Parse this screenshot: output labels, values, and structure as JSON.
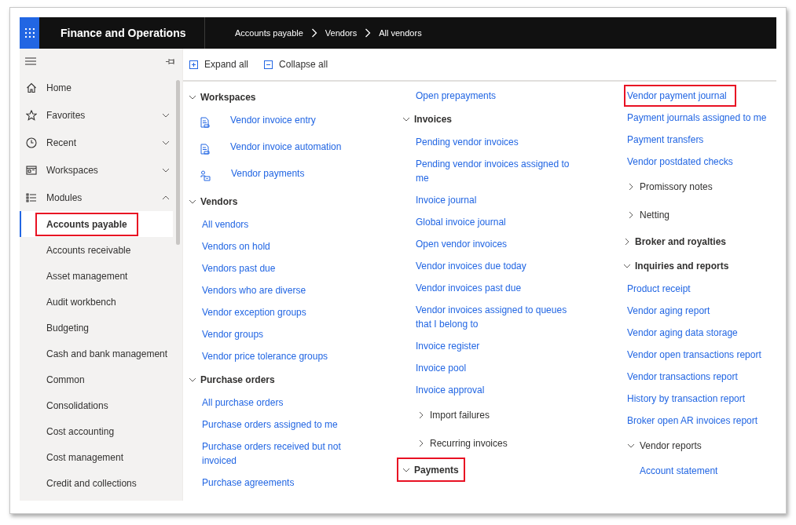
{
  "top_bar": {
    "app_title": "Finance and Operations",
    "breadcrumb": [
      "Accounts payable",
      "Vendors",
      "All vendors"
    ]
  },
  "nav": {
    "items": [
      {
        "kind": "link",
        "label": "Home"
      },
      {
        "kind": "expander",
        "label": "Favorites",
        "expanded": false
      },
      {
        "kind": "expander",
        "label": "Recent",
        "expanded": false
      },
      {
        "kind": "expander",
        "label": "Workspaces",
        "expanded": false
      },
      {
        "kind": "expander",
        "label": "Modules",
        "expanded": true
      }
    ],
    "modules": [
      {
        "label": "Accounts payable",
        "selected": true,
        "highlighted": true
      },
      {
        "label": "Accounts receivable",
        "selected": false,
        "highlighted": false
      },
      {
        "label": "Asset management",
        "selected": false,
        "highlighted": false
      },
      {
        "label": "Audit workbench",
        "selected": false,
        "highlighted": false
      },
      {
        "label": "Budgeting",
        "selected": false,
        "highlighted": false
      },
      {
        "label": "Cash and bank management",
        "selected": false,
        "highlighted": false
      },
      {
        "label": "Common",
        "selected": false,
        "highlighted": false
      },
      {
        "label": "Consolidations",
        "selected": false,
        "highlighted": false
      },
      {
        "label": "Cost accounting",
        "selected": false,
        "highlighted": false
      },
      {
        "label": "Cost management",
        "selected": false,
        "highlighted": false
      },
      {
        "label": "Credit and collections",
        "selected": false,
        "highlighted": false
      }
    ]
  },
  "toolbar": {
    "expand_all": "Expand all",
    "collapse_all": "Collapse all"
  },
  "columns": [
    {
      "items": [
        {
          "kind": "header",
          "label": "Workspaces",
          "expanded": true,
          "highlighted": false
        },
        {
          "kind": "workspace",
          "label": "Vendor invoice entry",
          "highlighted": false
        },
        {
          "kind": "workspace",
          "label": "Vendor invoice automation",
          "highlighted": false
        },
        {
          "kind": "workspace",
          "label": "Vendor payments",
          "highlighted": false
        },
        {
          "kind": "header",
          "label": "Vendors",
          "expanded": true,
          "highlighted": false
        },
        {
          "kind": "link",
          "label": "All vendors",
          "highlighted": false
        },
        {
          "kind": "link",
          "label": "Vendors on hold",
          "highlighted": false
        },
        {
          "kind": "link",
          "label": "Vendors past due",
          "highlighted": false
        },
        {
          "kind": "link",
          "label": "Vendors who are diverse",
          "highlighted": false
        },
        {
          "kind": "link",
          "label": "Vendor exception groups",
          "highlighted": false
        },
        {
          "kind": "link",
          "label": "Vendor groups",
          "highlighted": false
        },
        {
          "kind": "link",
          "label": "Vendor price tolerance groups",
          "highlighted": false
        },
        {
          "kind": "header",
          "label": "Purchase orders",
          "expanded": true,
          "highlighted": false
        },
        {
          "kind": "link",
          "label": "All purchase orders",
          "highlighted": false
        },
        {
          "kind": "link",
          "label": "Purchase orders assigned to me",
          "highlighted": false
        },
        {
          "kind": "link",
          "label": "Purchase orders received but not invoiced",
          "highlighted": false
        },
        {
          "kind": "link",
          "label": "Purchase agreements",
          "highlighted": false
        }
      ]
    },
    {
      "items": [
        {
          "kind": "link",
          "label": "Open prepayments",
          "highlighted": false
        },
        {
          "kind": "header",
          "label": "Invoices",
          "expanded": true,
          "highlighted": false
        },
        {
          "kind": "link",
          "label": "Pending vendor invoices",
          "highlighted": false
        },
        {
          "kind": "link",
          "label": "Pending vendor invoices assigned to me",
          "highlighted": false
        },
        {
          "kind": "link",
          "label": "Invoice journal",
          "highlighted": false
        },
        {
          "kind": "link",
          "label": "Global invoice journal",
          "highlighted": false
        },
        {
          "kind": "link",
          "label": "Open vendor invoices",
          "highlighted": false
        },
        {
          "kind": "link",
          "label": "Vendor invoices due today",
          "highlighted": false
        },
        {
          "kind": "link",
          "label": "Vendor invoices past due",
          "highlighted": false
        },
        {
          "kind": "link",
          "label": "Vendor invoices assigned to queues that I belong to",
          "highlighted": false
        },
        {
          "kind": "link",
          "label": "Invoice register",
          "highlighted": false
        },
        {
          "kind": "link",
          "label": "Invoice pool",
          "highlighted": false
        },
        {
          "kind": "link",
          "label": "Invoice approval",
          "highlighted": false
        },
        {
          "kind": "group",
          "label": "Import failures",
          "expanded": false,
          "highlighted": false
        },
        {
          "kind": "group",
          "label": "Recurring invoices",
          "expanded": false,
          "highlighted": false
        },
        {
          "kind": "header",
          "label": "Payments",
          "expanded": true,
          "highlighted": true
        }
      ]
    },
    {
      "items": [
        {
          "kind": "link",
          "label": "Vendor payment journal",
          "highlighted": true
        },
        {
          "kind": "link",
          "label": "Payment journals assigned to me",
          "highlighted": false
        },
        {
          "kind": "link",
          "label": "Payment transfers",
          "highlighted": false
        },
        {
          "kind": "link",
          "label": "Vendor postdated checks",
          "highlighted": false
        },
        {
          "kind": "group",
          "label": "Promissory notes",
          "expanded": false,
          "highlighted": false
        },
        {
          "kind": "group",
          "label": "Netting",
          "expanded": false,
          "highlighted": false
        },
        {
          "kind": "header",
          "label": "Broker and royalties",
          "expanded": false,
          "highlighted": false
        },
        {
          "kind": "header",
          "label": "Inquiries and reports",
          "expanded": true,
          "highlighted": false
        },
        {
          "kind": "link",
          "label": "Product receipt",
          "highlighted": false
        },
        {
          "kind": "link",
          "label": "Vendor aging report",
          "highlighted": false
        },
        {
          "kind": "link",
          "label": "Vendor aging data storage",
          "highlighted": false
        },
        {
          "kind": "link",
          "label": "Vendor open transactions report",
          "highlighted": false
        },
        {
          "kind": "link",
          "label": "Vendor transactions report",
          "highlighted": false
        },
        {
          "kind": "link",
          "label": "History by transaction report",
          "highlighted": false
        },
        {
          "kind": "link",
          "label": "Broker open AR invoices report",
          "highlighted": false
        },
        {
          "kind": "group",
          "label": "Vendor reports",
          "expanded": true,
          "highlighted": false,
          "children": [
            {
              "kind": "link",
              "label": "Account statement",
              "highlighted": false
            }
          ]
        }
      ]
    }
  ]
}
